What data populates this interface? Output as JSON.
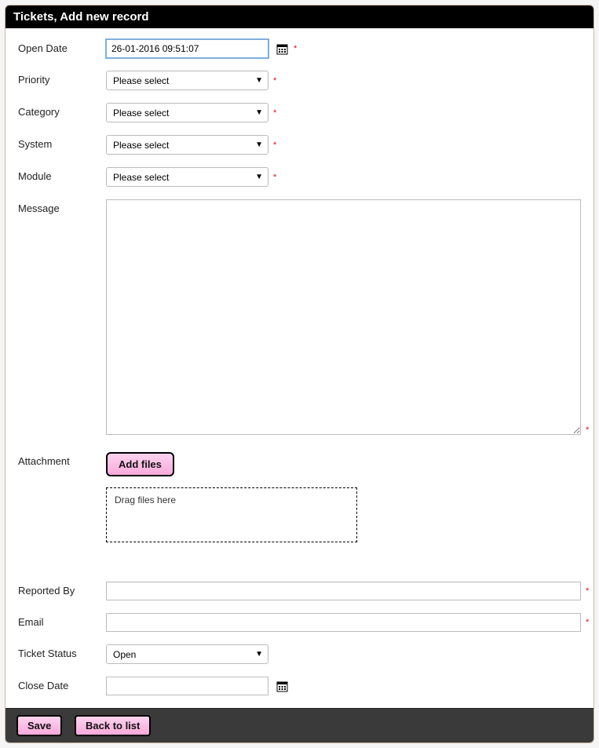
{
  "header": {
    "title": "Tickets, Add new record"
  },
  "fields": {
    "open_date": {
      "label": "Open Date",
      "value": "26-01-2016 09:51:07"
    },
    "priority": {
      "label": "Priority",
      "placeholder": "Please select"
    },
    "category": {
      "label": "Category",
      "placeholder": "Please select"
    },
    "system": {
      "label": "System",
      "placeholder": "Please select"
    },
    "module": {
      "label": "Module",
      "placeholder": "Please select"
    },
    "message": {
      "label": "Message",
      "value": ""
    },
    "attachment": {
      "label": "Attachment",
      "add_button": "Add files",
      "dropzone_text": "Drag files here"
    },
    "reported_by": {
      "label": "Reported By",
      "value": ""
    },
    "email": {
      "label": "Email",
      "value": ""
    },
    "ticket_status": {
      "label": "Ticket Status",
      "value": "Open"
    },
    "close_date": {
      "label": "Close Date",
      "value": ""
    }
  },
  "footer": {
    "save": "Save",
    "back": "Back to list"
  },
  "required_marker": "*"
}
